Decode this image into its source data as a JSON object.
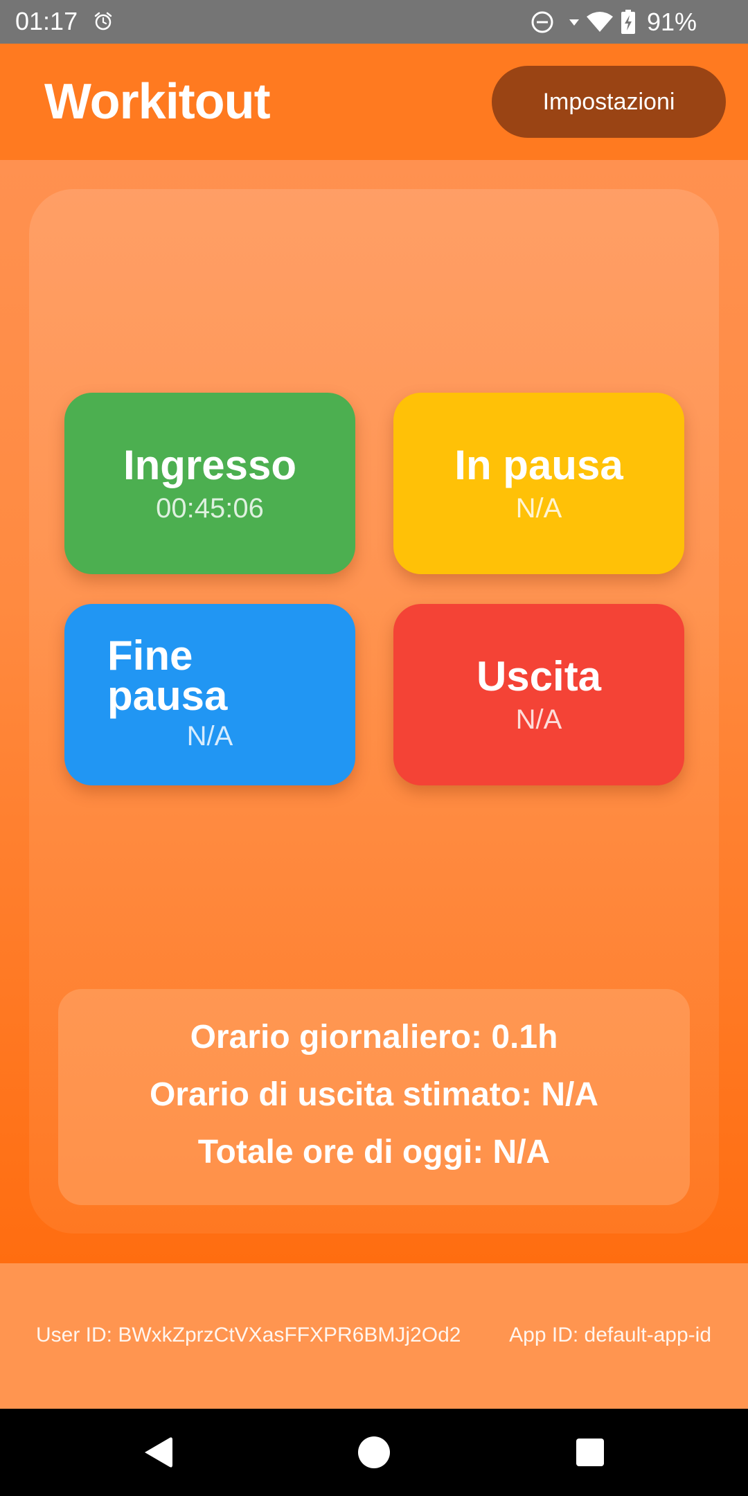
{
  "status_bar": {
    "time": "01:17",
    "battery_percent": "91%",
    "icons": [
      "alarm-icon",
      "do-not-disturb-icon",
      "wifi-icon",
      "battery-charging-icon"
    ]
  },
  "header": {
    "title": "Workitout",
    "settings_label": "Impostazioni"
  },
  "actions": {
    "ingresso": {
      "label": "Ingresso",
      "value": "00:45:06",
      "color": "#4caf50"
    },
    "in_pausa": {
      "label": "In pausa",
      "value": "N/A",
      "color": "#ffc107"
    },
    "fine_pausa": {
      "label": "Fine pausa",
      "value": "N/A",
      "color": "#2196f3"
    },
    "uscita": {
      "label": "Uscita",
      "value": "N/A",
      "color": "#f44336"
    }
  },
  "summary": {
    "daily_hours": "Orario giornaliero: 0.1h",
    "estimated_exit": "Orario di uscita stimato: N/A",
    "total_today": "Totale ore di oggi: N/A"
  },
  "footer": {
    "user_id": "User ID: BWxkZprzCtVXasFFXPR6BMJj2Od2",
    "app_id": "App ID: default-app-id"
  },
  "nav": {
    "icons": [
      "back-icon",
      "home-icon",
      "recents-icon"
    ]
  },
  "colors": {
    "accent": "#ff7a20",
    "settings_button": "#9a4414",
    "status_bar": "#757575"
  }
}
